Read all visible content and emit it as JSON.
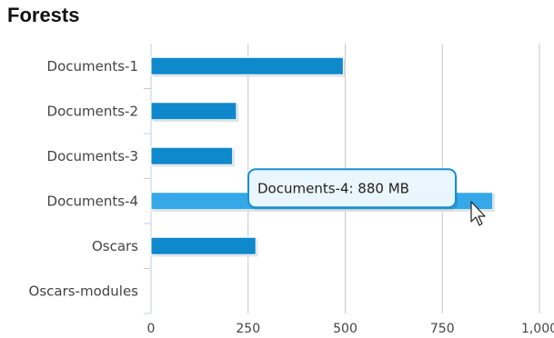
{
  "title": "Forests",
  "tooltip": {
    "text": "Documents-4: 880 MB",
    "category_index": 3
  },
  "colors": {
    "bar": "#0f88cc",
    "bar_hover": "#35a8e8",
    "grid": "#c8c8c8",
    "axis": "#c0d0e0",
    "tooltip_border": "#1a8fd0",
    "tooltip_bg": "#eaf6fd"
  },
  "chart_data": {
    "type": "bar",
    "orientation": "horizontal",
    "categories": [
      "Documents-1",
      "Documents-2",
      "Documents-3",
      "Documents-4",
      "Oscars",
      "Oscars-modules"
    ],
    "values": [
      495,
      220,
      210,
      880,
      270,
      0
    ],
    "unit": "MB",
    "xlim": [
      0,
      1000
    ],
    "ticks": [
      "0",
      "250",
      "500",
      "750",
      "1,000"
    ],
    "tick_values": [
      0,
      250,
      500,
      750,
      1000
    ],
    "grid": true,
    "title": "Forests"
  }
}
